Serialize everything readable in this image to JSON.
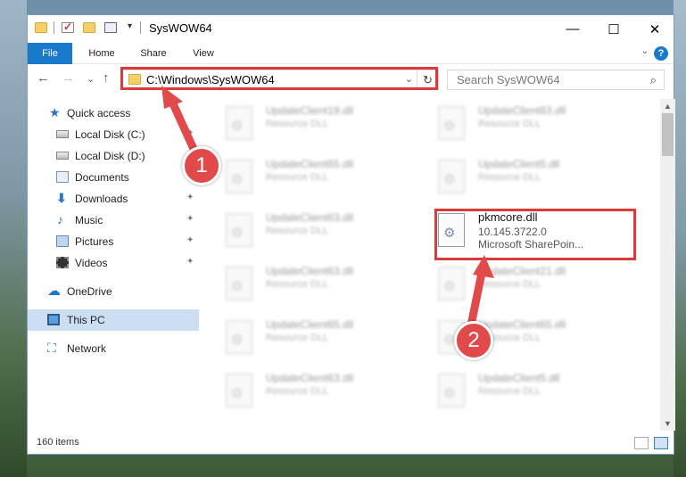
{
  "window": {
    "title": "SysWOW64",
    "min_glyph": "—",
    "max_glyph": "☐",
    "close_glyph": "✕"
  },
  "ribbon": {
    "tabs": [
      "File",
      "Home",
      "Share",
      "View"
    ],
    "help_glyph": "?"
  },
  "nav": {
    "back_glyph": "←",
    "forward_glyph": "→",
    "recent_glyph": "⌄",
    "up_glyph": "↑",
    "address": "C:\\Windows\\SysWOW64",
    "address_dropdown": "⌄",
    "refresh_glyph": "↻",
    "search_placeholder": "Search SysWOW64",
    "search_glyph": "⌕"
  },
  "sidebar": {
    "items": [
      {
        "label": "Quick access",
        "icon": "star-icon",
        "pinned": false
      },
      {
        "label": "Local Disk (C:)",
        "icon": "drive-icon",
        "pinned": true
      },
      {
        "label": "Local Disk (D:)",
        "icon": "drive-icon",
        "pinned": false
      },
      {
        "label": "Documents",
        "icon": "documents-icon",
        "pinned": true
      },
      {
        "label": "Downloads",
        "icon": "download-icon",
        "pinned": true
      },
      {
        "label": "Music",
        "icon": "music-icon",
        "pinned": true
      },
      {
        "label": "Pictures",
        "icon": "pictures-icon",
        "pinned": true
      },
      {
        "label": "Videos",
        "icon": "videos-icon",
        "pinned": true
      },
      {
        "label": "OneDrive",
        "icon": "onedrive-icon",
        "pinned": false
      },
      {
        "label": "This PC",
        "icon": "this-pc-icon",
        "pinned": false,
        "selected": true
      },
      {
        "label": "Network",
        "icon": "network-icon",
        "pinned": false
      }
    ],
    "pin_glyph": "📌"
  },
  "files": [
    {
      "name": "UpdateClient19.dll",
      "desc": "Resource DLL"
    },
    {
      "name": "UpdateClient63.dll",
      "desc": "Resource DLL"
    },
    {
      "name": "UpdateClient65.dll",
      "desc": "Resource DLL"
    },
    {
      "name": "UpdateClient5.dll",
      "desc": "Resource DLL"
    },
    {
      "name": "UpdateClient63.dll",
      "desc": "Resource DLL"
    },
    {
      "name": "pkmcore.dll",
      "version": "10.145.3722.0",
      "company": "Microsoft SharePoin...",
      "highlighted": true
    },
    {
      "name": "UpdateClient63.dll",
      "desc": "Resource DLL"
    },
    {
      "name": "UpdateClient21.dll",
      "desc": "Resource DLL"
    },
    {
      "name": "UpdateClient65.dll",
      "desc": "Resource DLL"
    },
    {
      "name": "UpdateClient65.dll",
      "desc": "Resource DLL"
    },
    {
      "name": "UpdateClient63.dll",
      "desc": "Resource DLL"
    },
    {
      "name": "UpdateClient5.dll",
      "desc": "Resource DLL"
    }
  ],
  "status": {
    "item_count": "160 items"
  },
  "callouts": {
    "step1": "1",
    "step2": "2",
    "color": "#d93a3a"
  }
}
